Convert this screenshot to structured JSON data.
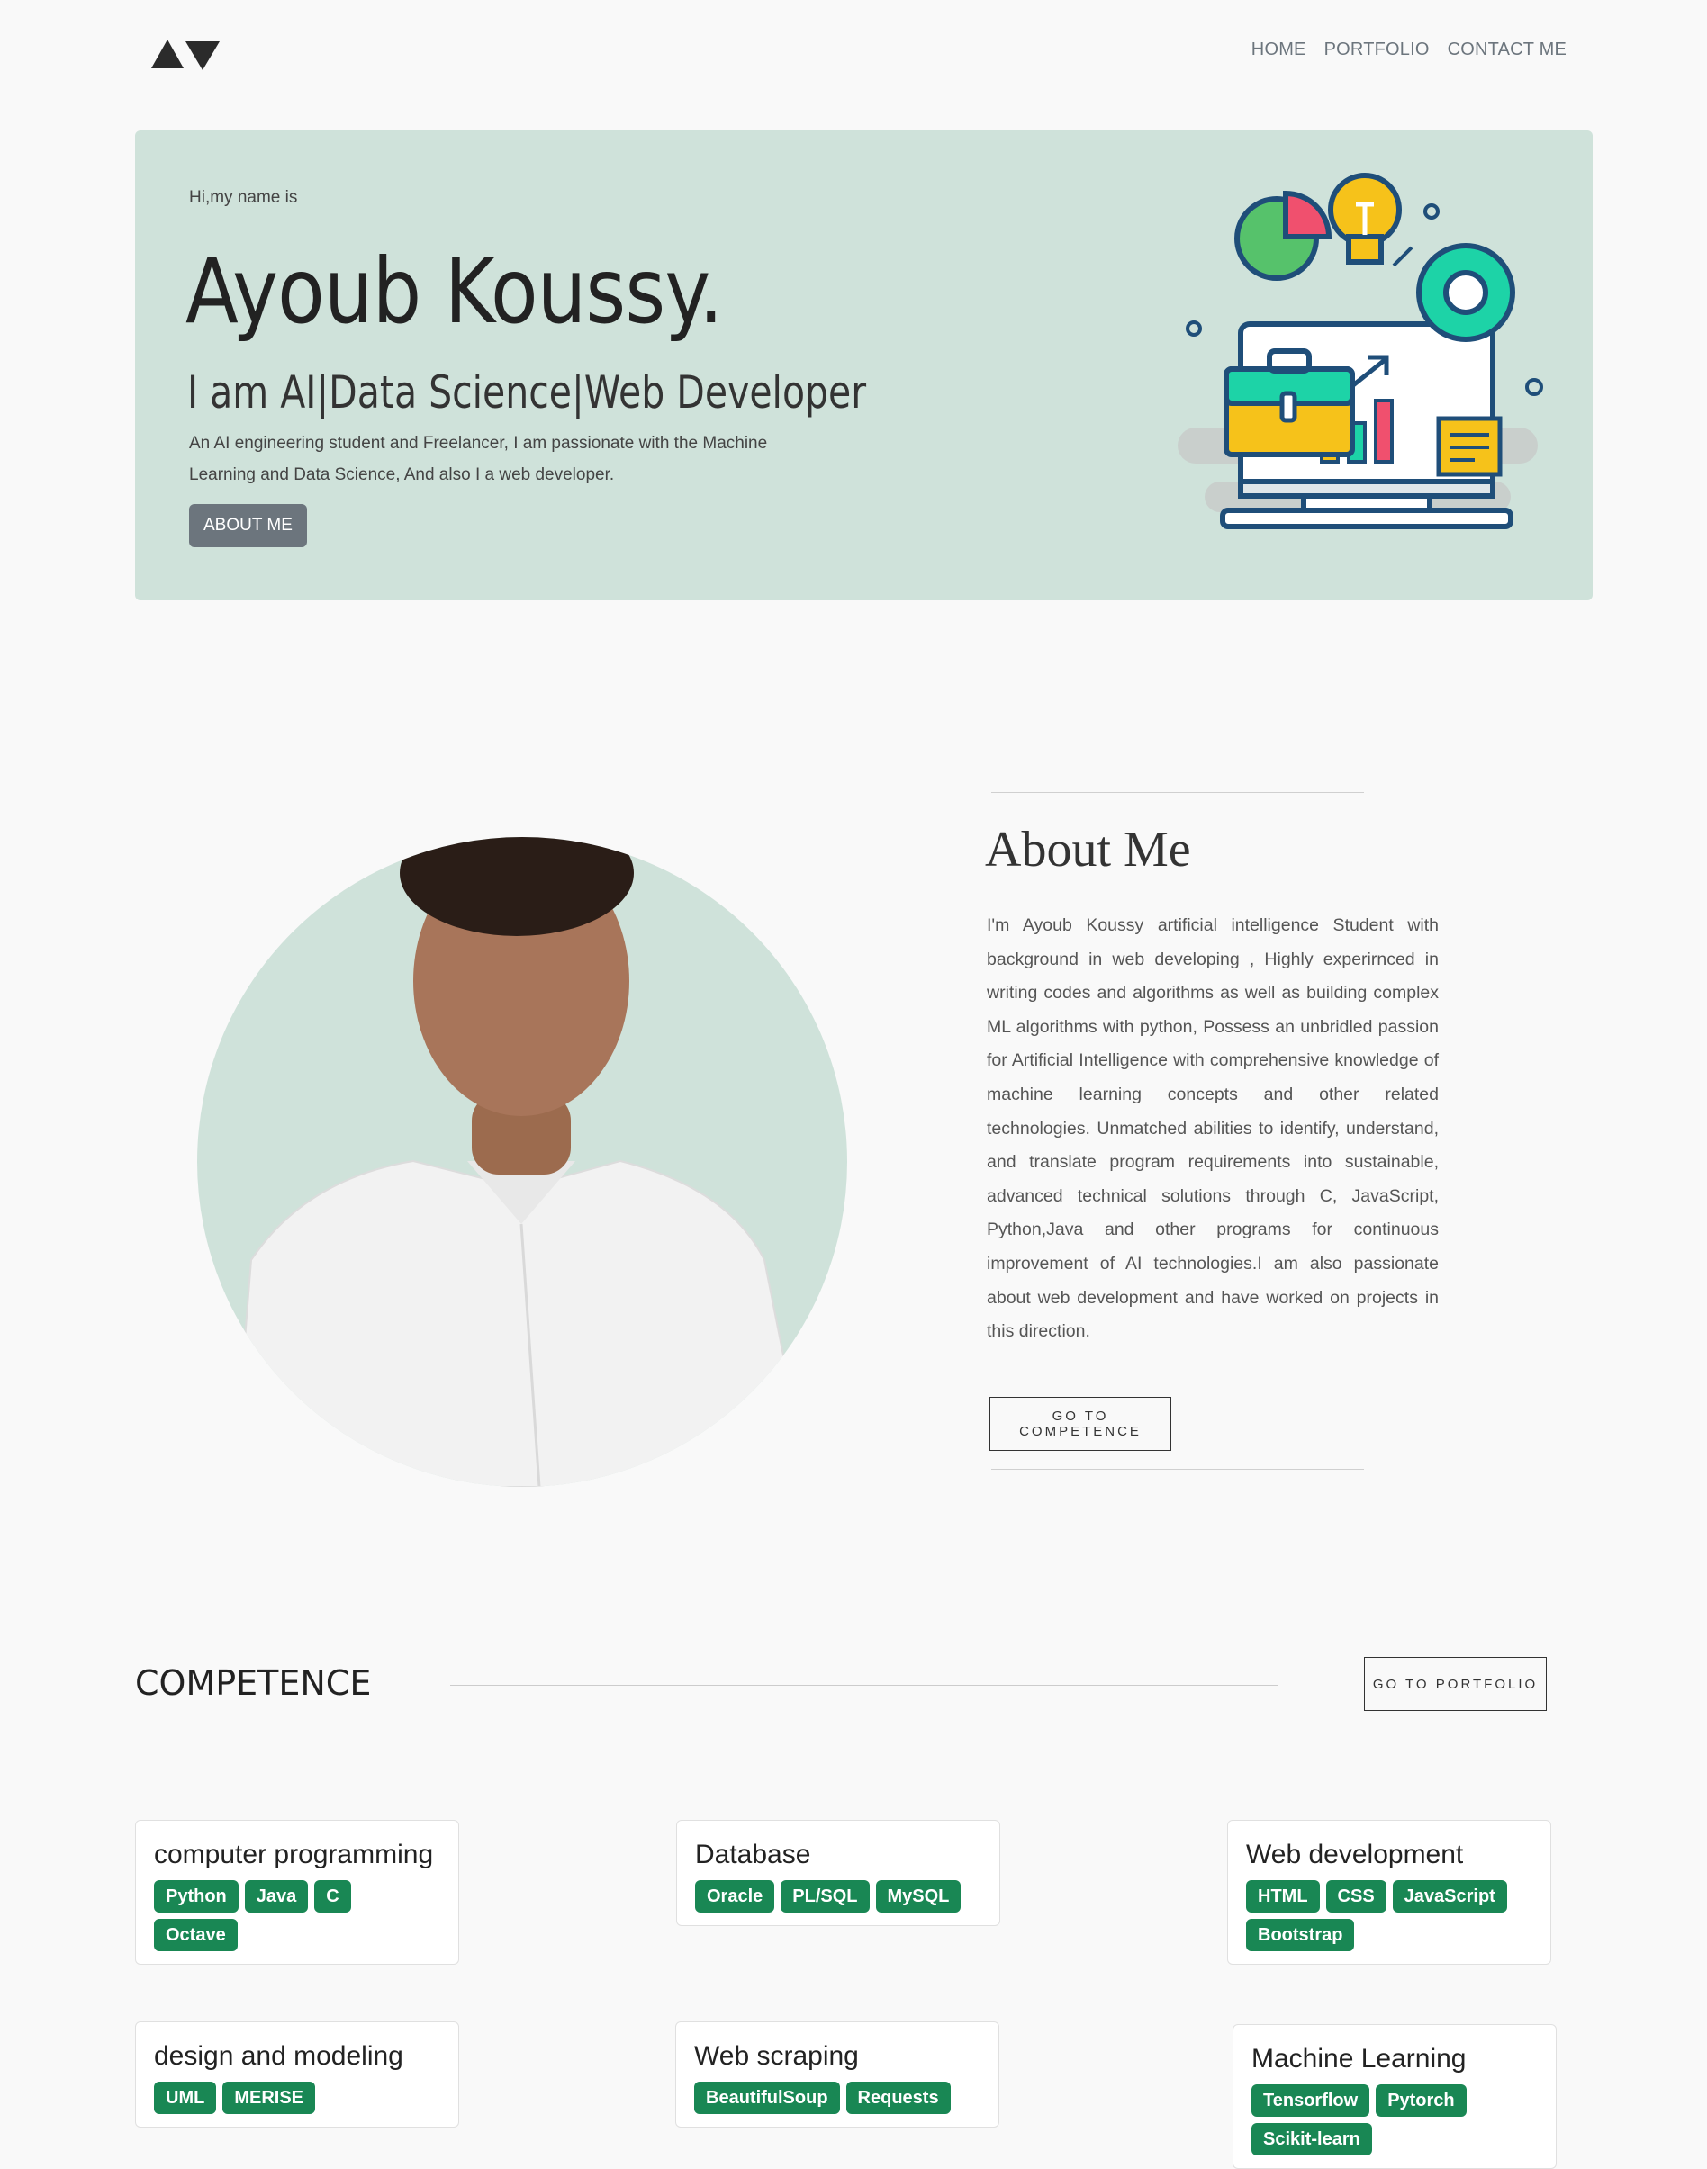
{
  "nav": {
    "logo": "logo",
    "items": [
      "HOME",
      "PORTFOLIO",
      "CONTACT ME"
    ]
  },
  "hero": {
    "greeting": "Hi,my name is",
    "name": "Ayoub Koussy.",
    "role": "I am AI|Data Science|Web Developer",
    "description_line1": "An AI engineering student and Freelancer, I am passionate with the Machine",
    "description_line2": "Learning and Data Science, And also I a web developer.",
    "button": "ABOUT ME",
    "illustration": "business-laptop-illustration"
  },
  "about": {
    "title": "About Me",
    "text": "I'm Ayoub Koussy artificial intelligence Student with background in web developing , Highly experirnced in writing codes and algorithms as well as building complex ML algorithms with python, Possess an unbridled passion for Artificial Intelligence with comprehensive knowledge of machine learning concepts and other related technologies. Unmatched abilities to identify, understand, and translate program requirements into sustainable, advanced technical solutions through C, JavaScript, Python,Java and other programs for continuous improvement of AI technologies.I am also passionate about web development and have worked on projects in this direction.",
    "button": "GO TO COMPETENCE",
    "photo": "profile-photo"
  },
  "competence": {
    "title": "COMPETENCE",
    "button": "GO TO PORTFOLIO",
    "cards": [
      {
        "title": "computer programming",
        "skills": [
          "Python",
          "Java",
          "C",
          "Octave"
        ]
      },
      {
        "title": "Database",
        "skills": [
          "Oracle",
          "PL/SQL",
          "MySQL"
        ]
      },
      {
        "title": "Web development",
        "skills": [
          "HTML",
          "CSS",
          "JavaScript",
          "Bootstrap"
        ]
      },
      {
        "title": "design and modeling",
        "skills": [
          "UML",
          "MERISE"
        ]
      },
      {
        "title": "Web scraping",
        "skills": [
          "BeautifulSoup",
          "Requests"
        ]
      },
      {
        "title": "Machine Learning",
        "skills": [
          "Tensorflow",
          "Pytorch",
          "Scikit-learn"
        ]
      }
    ]
  },
  "colors": {
    "accent_bg": "#cfe2da",
    "badge": "#198754",
    "button_gray": "#6c757d"
  }
}
